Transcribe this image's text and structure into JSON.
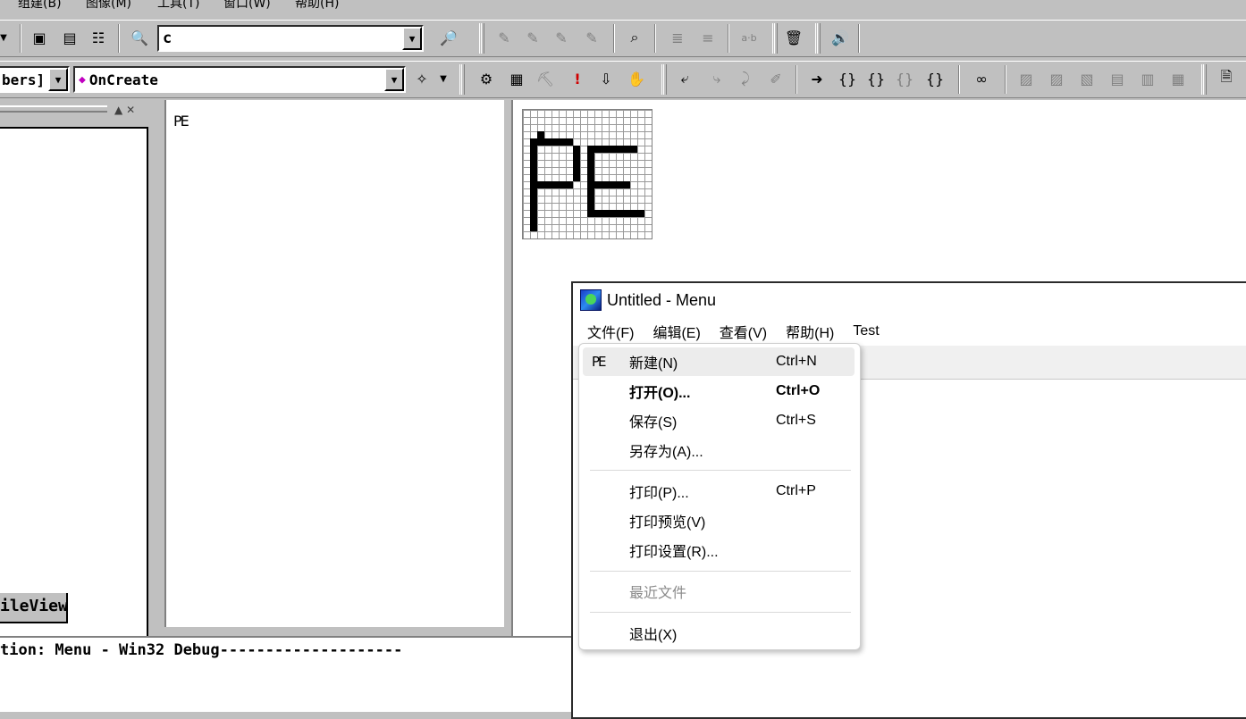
{
  "ide": {
    "menubar": [
      "组建(B)",
      "图像(M)",
      "工具(T)",
      "窗口(W)",
      "帮助(H)"
    ],
    "find_combo_value": "c",
    "class_combo_value": "bers]",
    "function_combo_value": "OnCreate",
    "workspace_tab": "ileView",
    "resource_item": "PE",
    "output_line": "tion: Menu - Win32 Debug--------------------"
  },
  "app": {
    "title": "Untitled - Menu",
    "menus": [
      "文件(F)",
      "编辑(E)",
      "查看(V)",
      "帮助(H)",
      "Test"
    ]
  },
  "file_menu": {
    "items": [
      {
        "label": "新建(N)",
        "shortcut": "Ctrl+N",
        "icon": "PE"
      },
      {
        "label": "打开(O)...",
        "shortcut": "Ctrl+O"
      },
      {
        "label": "保存(S)",
        "shortcut": "Ctrl+S"
      },
      {
        "label": "另存为(A)..."
      },
      {
        "label": "打印(P)...",
        "shortcut": "Ctrl+P"
      },
      {
        "label": "打印预览(V)"
      },
      {
        "label": "打印设置(R)..."
      },
      {
        "label": "最近文件"
      },
      {
        "label": "退出(X)"
      }
    ]
  }
}
